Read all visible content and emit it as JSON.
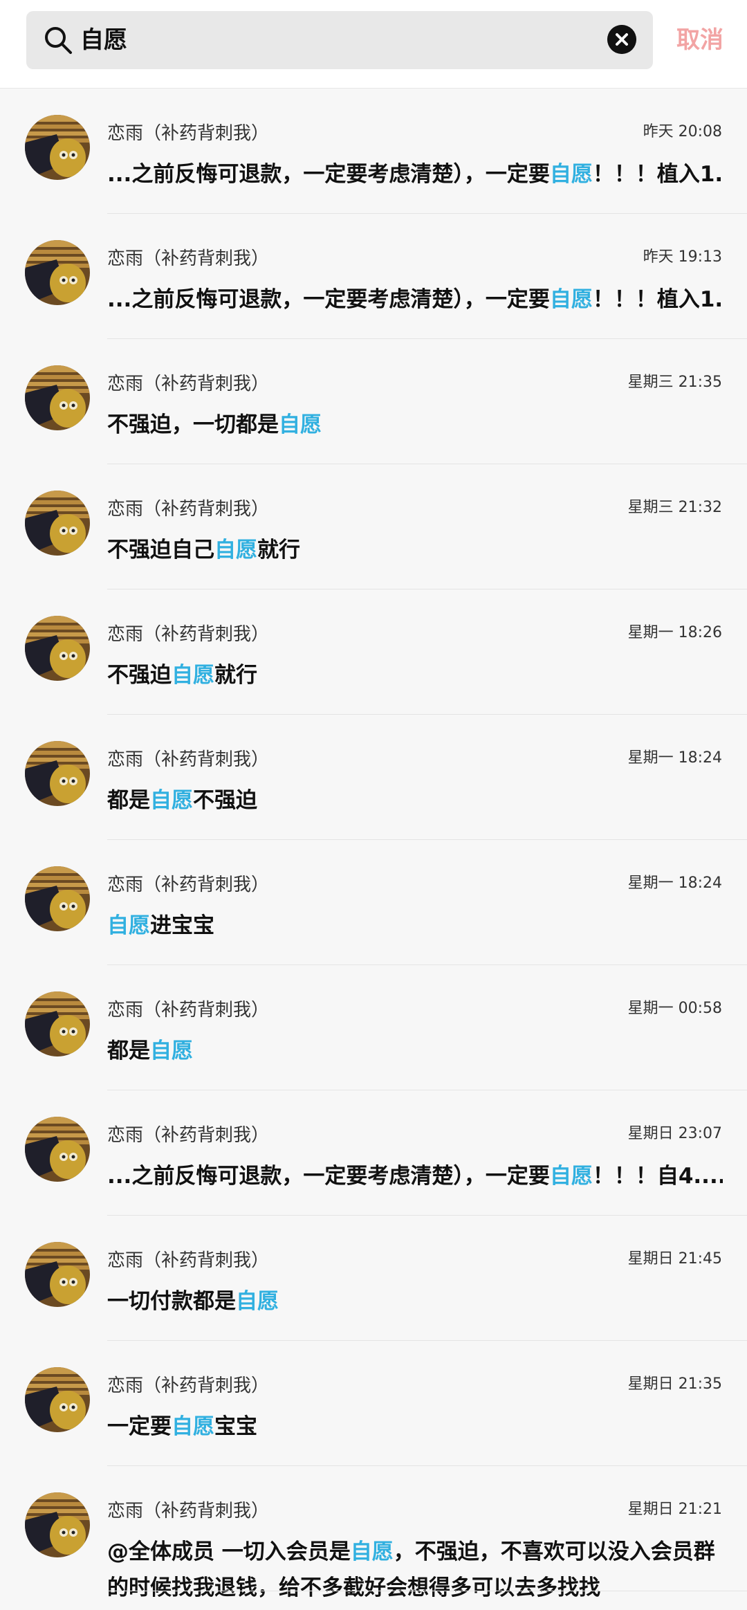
{
  "search": {
    "query": "自愿",
    "cancel_label": "取消"
  },
  "results": [
    {
      "name": "恋雨（补药背刺我）",
      "time": "昨天 20:08",
      "pre": "...之前反悔可退款，一定要考虑清楚），一定要",
      "hl": "自愿",
      "post": "！！！植入1..."
    },
    {
      "name": "恋雨（补药背刺我）",
      "time": "昨天 19:13",
      "pre": "...之前反悔可退款，一定要考虑清楚），一定要",
      "hl": "自愿",
      "post": "！！！植入1..."
    },
    {
      "name": "恋雨（补药背刺我）",
      "time": "星期三 21:35",
      "pre": "不强迫，一切都是",
      "hl": "自愿",
      "post": ""
    },
    {
      "name": "恋雨（补药背刺我）",
      "time": "星期三 21:32",
      "pre": "不强迫自己",
      "hl": "自愿",
      "post": "就行"
    },
    {
      "name": "恋雨（补药背刺我）",
      "time": "星期一 18:26",
      "pre": "不强迫",
      "hl": "自愿",
      "post": "就行"
    },
    {
      "name": "恋雨（补药背刺我）",
      "time": "星期一 18:24",
      "pre": "都是",
      "hl": "自愿",
      "post": "不强迫"
    },
    {
      "name": "恋雨（补药背刺我）",
      "time": "星期一 18:24",
      "pre": "",
      "hl": "自愿",
      "post": "进宝宝"
    },
    {
      "name": "恋雨（补药背刺我）",
      "time": "星期一 00:58",
      "pre": "都是",
      "hl": "自愿",
      "post": ""
    },
    {
      "name": "恋雨（补药背刺我）",
      "time": "星期日 23:07",
      "pre": "...之前反悔可退款，一定要考虑清楚），一定要",
      "hl": "自愿",
      "post": "！！！自4...."
    },
    {
      "name": "恋雨（补药背刺我）",
      "time": "星期日 21:45",
      "pre": "一切付款都是",
      "hl": "自愿",
      "post": ""
    },
    {
      "name": "恋雨（补药背刺我）",
      "time": "星期日 21:35",
      "pre": "一定要",
      "hl": "自愿",
      "post": "宝宝"
    },
    {
      "name": "恋雨（补药背刺我）",
      "time": "星期日 21:21",
      "pre": "@全体成员  一切入会员是",
      "hl": "自愿",
      "post": "，不强迫，不喜欢可以没入会员群的时候找我退钱，给不多截好会想得多可以去多找找"
    }
  ],
  "colors": {
    "highlight": "#31b0e0",
    "cancel": "#f2a4a4",
    "background": "#f7f7f7"
  },
  "icons": {
    "search": "search-icon",
    "clear": "clear-icon"
  }
}
